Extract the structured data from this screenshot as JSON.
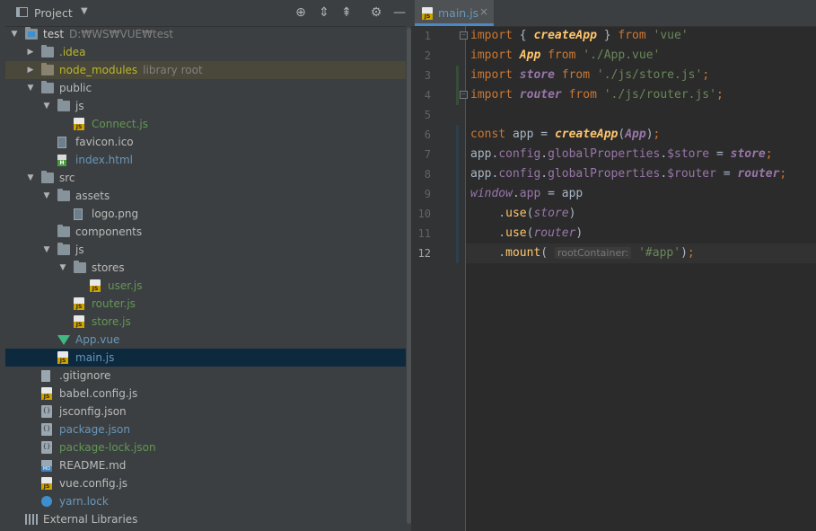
{
  "project_panel": {
    "title": "Project",
    "toolbar": [
      "crosshair-icon",
      "expand-all-icon",
      "collapse-all-icon",
      "gear-icon",
      "hide-icon"
    ],
    "tree": [
      {
        "depth": 0,
        "arrow": "down",
        "icon": "folder-module",
        "label": "test",
        "suffix": "D:₩WS₩VUE₩test",
        "color": "default",
        "bold": true
      },
      {
        "depth": 1,
        "arrow": "right",
        "icon": "folder",
        "label": ".idea",
        "color": "yellow"
      },
      {
        "depth": 1,
        "arrow": "right",
        "icon": "folder-lib",
        "label": "node_modules",
        "suffix": "library root",
        "color": "yellow",
        "lib": true
      },
      {
        "depth": 1,
        "arrow": "down",
        "icon": "folder",
        "label": "public",
        "color": "default"
      },
      {
        "depth": 2,
        "arrow": "down",
        "icon": "folder",
        "label": "js",
        "color": "default"
      },
      {
        "depth": 3,
        "arrow": "none",
        "icon": "js",
        "label": "Connect.js",
        "color": "green"
      },
      {
        "depth": 2,
        "arrow": "none",
        "icon": "image",
        "label": "favicon.ico",
        "color": "default"
      },
      {
        "depth": 2,
        "arrow": "none",
        "icon": "html",
        "label": "index.html",
        "color": "blue"
      },
      {
        "depth": 1,
        "arrow": "down",
        "icon": "folder",
        "label": "src",
        "color": "default"
      },
      {
        "depth": 2,
        "arrow": "down",
        "icon": "folder",
        "label": "assets",
        "color": "default"
      },
      {
        "depth": 3,
        "arrow": "none",
        "icon": "image",
        "label": "logo.png",
        "color": "default"
      },
      {
        "depth": 2,
        "arrow": "none",
        "icon": "folder",
        "label": "components",
        "color": "default"
      },
      {
        "depth": 2,
        "arrow": "down",
        "icon": "folder",
        "label": "js",
        "color": "default"
      },
      {
        "depth": 3,
        "arrow": "down",
        "icon": "folder",
        "label": "stores",
        "color": "default"
      },
      {
        "depth": 4,
        "arrow": "none",
        "icon": "js",
        "label": "user.js",
        "color": "green"
      },
      {
        "depth": 3,
        "arrow": "none",
        "icon": "js",
        "label": "router.js",
        "color": "green"
      },
      {
        "depth": 3,
        "arrow": "none",
        "icon": "js",
        "label": "store.js",
        "color": "green"
      },
      {
        "depth": 2,
        "arrow": "none",
        "icon": "vue",
        "label": "App.vue",
        "color": "blue"
      },
      {
        "depth": 2,
        "arrow": "none",
        "icon": "js",
        "label": "main.js",
        "color": "blue",
        "selected": true
      },
      {
        "depth": 1,
        "arrow": "none",
        "icon": "text",
        "label": ".gitignore",
        "color": "default"
      },
      {
        "depth": 1,
        "arrow": "none",
        "icon": "js",
        "label": "babel.config.js",
        "color": "default"
      },
      {
        "depth": 1,
        "arrow": "none",
        "icon": "json",
        "label": "jsconfig.json",
        "color": "default"
      },
      {
        "depth": 1,
        "arrow": "none",
        "icon": "json",
        "label": "package.json",
        "color": "blue"
      },
      {
        "depth": 1,
        "arrow": "none",
        "icon": "json",
        "label": "package-lock.json",
        "color": "green"
      },
      {
        "depth": 1,
        "arrow": "none",
        "icon": "md",
        "label": "README.md",
        "color": "default"
      },
      {
        "depth": 1,
        "arrow": "none",
        "icon": "js",
        "label": "vue.config.js",
        "color": "default"
      },
      {
        "depth": 1,
        "arrow": "none",
        "icon": "yarn",
        "label": "yarn.lock",
        "color": "blue"
      },
      {
        "depth": 0,
        "arrow": "none",
        "icon": "lib",
        "label": "External Libraries",
        "color": "default"
      }
    ]
  },
  "editor": {
    "tab": {
      "label": "main.js",
      "close": "×"
    },
    "current_line": 12,
    "lines": [
      {
        "n": 1,
        "tokens": [
          [
            "kw",
            "import"
          ],
          [
            "p",
            " { "
          ],
          [
            "fn",
            "createApp"
          ],
          [
            "p",
            " } "
          ],
          [
            "kw",
            "from"
          ],
          [
            "p",
            " "
          ],
          [
            "str",
            "'vue'"
          ]
        ]
      },
      {
        "n": 2,
        "tokens": [
          [
            "kw",
            "import"
          ],
          [
            "p",
            " "
          ],
          [
            "fn",
            "App"
          ],
          [
            "p",
            " "
          ],
          [
            "kw",
            "from"
          ],
          [
            "p",
            " "
          ],
          [
            "str",
            "'./App.vue'"
          ]
        ]
      },
      {
        "n": 3,
        "tokens": [
          [
            "kw",
            "import"
          ],
          [
            "p",
            " "
          ],
          [
            "it",
            "store"
          ],
          [
            "p",
            " "
          ],
          [
            "kw",
            "from"
          ],
          [
            "p",
            " "
          ],
          [
            "str",
            "'./js/store.js'"
          ],
          [
            "kw",
            ";"
          ]
        ]
      },
      {
        "n": 4,
        "tokens": [
          [
            "kw",
            "import"
          ],
          [
            "p",
            " "
          ],
          [
            "it",
            "router"
          ],
          [
            "p",
            " "
          ],
          [
            "kw",
            "from"
          ],
          [
            "p",
            " "
          ],
          [
            "str",
            "'./js/router.js'"
          ],
          [
            "kw",
            ";"
          ]
        ]
      },
      {
        "n": 5,
        "tokens": []
      },
      {
        "n": 6,
        "tokens": [
          [
            "kw",
            "const"
          ],
          [
            "p",
            " app = "
          ],
          [
            "fn",
            "createApp"
          ],
          [
            "p",
            "("
          ],
          [
            "it",
            "App"
          ],
          [
            "p",
            ")"
          ],
          [
            "kw",
            ";"
          ]
        ]
      },
      {
        "n": 7,
        "tokens": [
          [
            "p",
            "app."
          ],
          [
            "prop",
            "config"
          ],
          [
            "p",
            "."
          ],
          [
            "prop",
            "globalProperties"
          ],
          [
            "p",
            "."
          ],
          [
            "prop",
            "$store"
          ],
          [
            "p",
            " = "
          ],
          [
            "it",
            "store"
          ],
          [
            "kw",
            ";"
          ]
        ]
      },
      {
        "n": 8,
        "tokens": [
          [
            "p",
            "app."
          ],
          [
            "prop",
            "config"
          ],
          [
            "p",
            "."
          ],
          [
            "prop",
            "globalProperties"
          ],
          [
            "p",
            "."
          ],
          [
            "prop",
            "$router"
          ],
          [
            "p",
            " = "
          ],
          [
            "it",
            "router"
          ],
          [
            "kw",
            ";"
          ]
        ]
      },
      {
        "n": 9,
        "tokens": [
          [
            "glob",
            "window"
          ],
          [
            "p",
            "."
          ],
          [
            "prop",
            "app"
          ],
          [
            "p",
            " = app"
          ]
        ]
      },
      {
        "n": 10,
        "tokens": [
          [
            "p",
            "    ."
          ],
          [
            "meth",
            "use"
          ],
          [
            "p",
            "("
          ],
          [
            "glob",
            "store"
          ],
          [
            "p",
            ")"
          ]
        ]
      },
      {
        "n": 11,
        "tokens": [
          [
            "p",
            "    ."
          ],
          [
            "meth",
            "use"
          ],
          [
            "p",
            "("
          ],
          [
            "glob",
            "router"
          ],
          [
            "p",
            ")"
          ]
        ]
      },
      {
        "n": 12,
        "tokens": [
          [
            "p",
            "    ."
          ],
          [
            "meth",
            "mount"
          ],
          [
            "p",
            "( "
          ],
          [
            "hint",
            "rootContainer:"
          ],
          [
            "p",
            " "
          ],
          [
            "str",
            "'#app'"
          ],
          [
            "p",
            ")"
          ],
          [
            "kw",
            ";"
          ]
        ]
      }
    ]
  }
}
